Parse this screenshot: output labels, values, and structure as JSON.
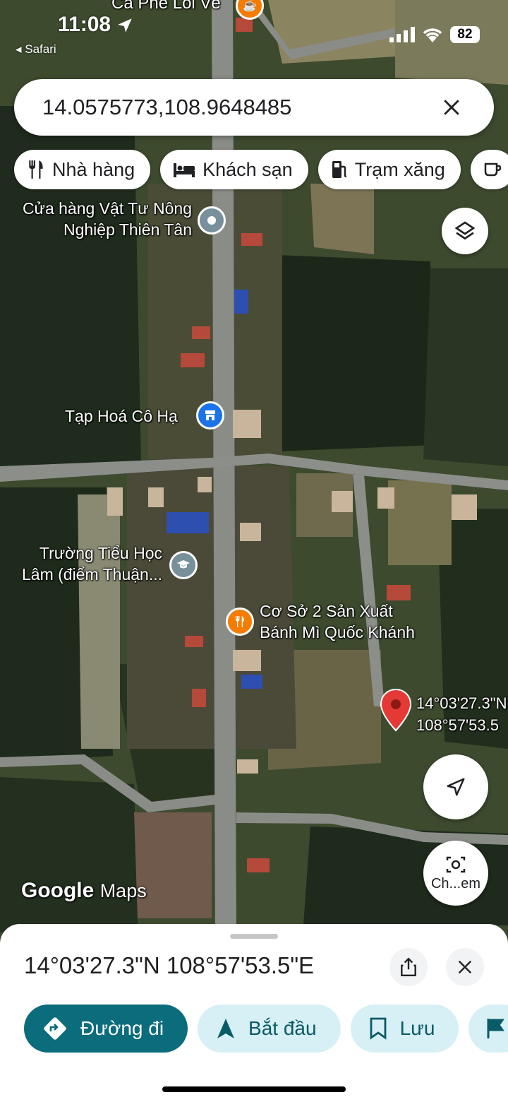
{
  "status_bar": {
    "time": "11:08",
    "back_app": "Safari",
    "battery": "82"
  },
  "search": {
    "query": "14.0575773,108.9648485"
  },
  "chips": [
    {
      "label": "Nhà hàng",
      "icon": "fork-knife-icon"
    },
    {
      "label": "Khách sạn",
      "icon": "bed-icon"
    },
    {
      "label": "Trạm xăng",
      "icon": "gas-pump-icon"
    }
  ],
  "map": {
    "places": {
      "top_cafe": "Cà Phê Lối Về",
      "store_line1": "Cửa hàng Vật Tư Nông",
      "store_line2": "Nghiệp Thiên Tân",
      "grocery": "Tạp Hoá Cô Hạ",
      "school_line1": "Trường Tiểu Học",
      "school_line2": "Lâm (điểm Thuận...",
      "bakery_line1": "Cơ Sở 2 Sản Xuất",
      "bakery_line2": "Bánh Mì Quốc Khánh"
    },
    "marker": {
      "lat_label": "14°03'27.3\"N",
      "lng_label": "108°57'53.5"
    },
    "camera_button_label": "Ch...em",
    "logo_google": "Google",
    "logo_maps": "Maps",
    "colors": {
      "marker": "#e53935",
      "restaurant_pin": "#f57c00",
      "shop_pin": "#1a73e8",
      "generic_pin": "#78909c"
    }
  },
  "sheet": {
    "title": "14°03'27.3\"N 108°57'53.5\"E",
    "actions": {
      "directions": "Đường đi",
      "start": "Bắt đầu",
      "save": "Lưu"
    },
    "colors": {
      "primary": "#0b6c7c",
      "secondary": "#d7f0f5"
    }
  }
}
